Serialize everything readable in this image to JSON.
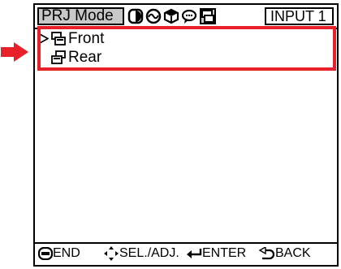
{
  "header": {
    "mode_tab_label": "PRJ Mode",
    "input_label": "INPUT  1",
    "icon_tabs": [
      "picture-tab-icon",
      "fine-sync-tab-icon",
      "options-tab-icon",
      "language-tab-icon",
      "prj-mode-tab-icon"
    ],
    "active_icon_tab": "prj-mode-tab-icon"
  },
  "menu": {
    "items": [
      {
        "label": "Front",
        "selected": true,
        "icon": "front-projection-icon"
      },
      {
        "label": "Rear",
        "selected": false,
        "icon": "rear-projection-icon"
      }
    ]
  },
  "footer": {
    "end_label": "END",
    "sel_adj_label": "SEL./ADJ.",
    "enter_label": "ENTER",
    "back_label": "BACK"
  },
  "colors": {
    "highlight": "#e8202a",
    "tab_fill": "#c8c8c8"
  }
}
